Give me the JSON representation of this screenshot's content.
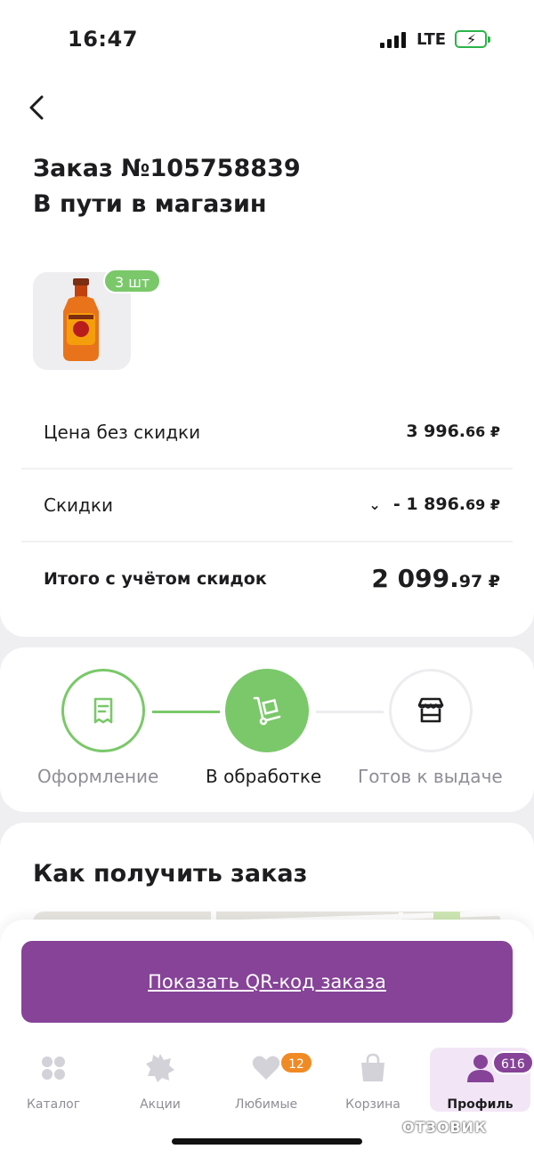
{
  "status_bar": {
    "time": "16:47",
    "network": "LTE"
  },
  "order": {
    "title": "Заказ №105758839",
    "status": "В пути в магазин",
    "item_quantity": "3 шт",
    "price_label": "Цена без скидки",
    "price_value": "3 996.66 ₽",
    "discount_label": "Скидки",
    "discount_main": "- 1 896.",
    "discount_cents": "69 ₽",
    "total_label": "Итого с учётом скидок",
    "total_main": "2 099.",
    "total_cents": "97 ₽",
    "price_main": "3 996.",
    "price_cents": "66 ₽"
  },
  "progress": {
    "steps": [
      {
        "label": "Оформление",
        "state": "done"
      },
      {
        "label": "В обработке",
        "state": "current"
      },
      {
        "label": "Готов к выдаче",
        "state": "pending"
      }
    ]
  },
  "receive": {
    "title": "Как получить заказ"
  },
  "qr_button": {
    "label": "Показать QR-код заказа"
  },
  "tabbar": {
    "items": [
      {
        "label": "Каталог"
      },
      {
        "label": "Акции"
      },
      {
        "label": "Любимые",
        "badge": "12"
      },
      {
        "label": "Корзина"
      },
      {
        "label": "Профиль",
        "badge": "616",
        "active": true
      }
    ]
  },
  "watermark": "ОТЗОВИК",
  "colors": {
    "accent_purple": "#864398",
    "accent_green": "#7ac86a",
    "badge_orange": "#f08a24"
  }
}
